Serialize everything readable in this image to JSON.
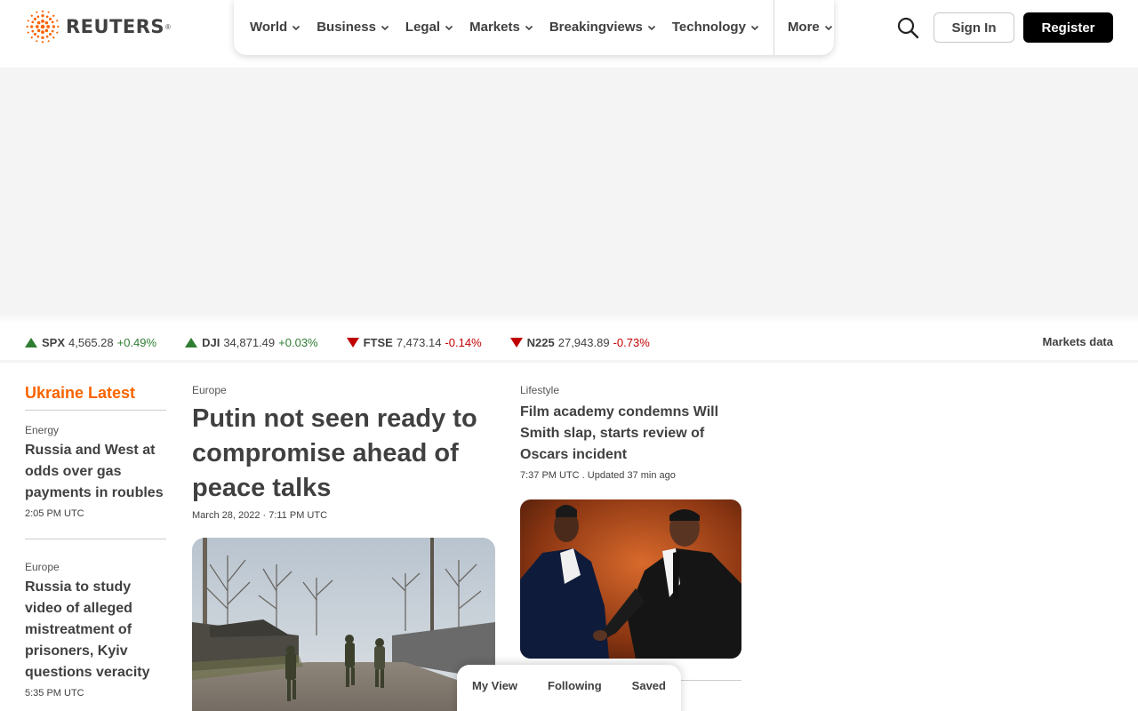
{
  "brand": {
    "name": "REUTERS",
    "reg": "®",
    "accent": "#fa6400"
  },
  "nav": {
    "items": [
      {
        "label": "World"
      },
      {
        "label": "Business"
      },
      {
        "label": "Legal"
      },
      {
        "label": "Markets"
      },
      {
        "label": "Breakingviews"
      },
      {
        "label": "Technology"
      }
    ],
    "more_label": "More"
  },
  "header": {
    "signin_label": "Sign In",
    "register_label": "Register"
  },
  "ticker": [
    {
      "symbol": "SPX",
      "value": "4,565.28",
      "change": "+0.49%",
      "direction": "up"
    },
    {
      "symbol": "DJI",
      "value": "34,871.49",
      "change": "+0.03%",
      "direction": "up"
    },
    {
      "symbol": "FTSE",
      "value": "7,473.14",
      "change": "-0.14%",
      "direction": "down"
    },
    {
      "symbol": "N225",
      "value": "27,943.89",
      "change": "-0.73%",
      "direction": "down"
    }
  ],
  "ticker_colors": {
    "up": "#2e7d32",
    "down": "#c00000"
  },
  "markets_data_label": "Markets data",
  "ukraine": {
    "title": "Ukraine Latest",
    "stories": [
      {
        "kicker": "Energy",
        "headline": "Russia and West at odds over gas payments in roubles",
        "time": "2:05 PM UTC"
      },
      {
        "kicker": "Europe",
        "headline": "Russia to study video of alleged mistreatment of prisoners, Kyiv questions veracity",
        "time": "5:35 PM UTC"
      }
    ]
  },
  "lead": {
    "kicker": "Europe",
    "headline": "Putin not seen ready to compromise ahead of peace talks",
    "time": "March 28, 2022 · 7:11 PM UTC"
  },
  "secondary": {
    "kicker": "Lifestyle",
    "headline": "Film academy condemns Will Smith slap, starts review of Oscars incident",
    "time": "7:37 PM UTC . Updated 37 min ago"
  },
  "bottom_bar": {
    "my_view": "My View",
    "following": "Following",
    "saved": "Saved"
  }
}
